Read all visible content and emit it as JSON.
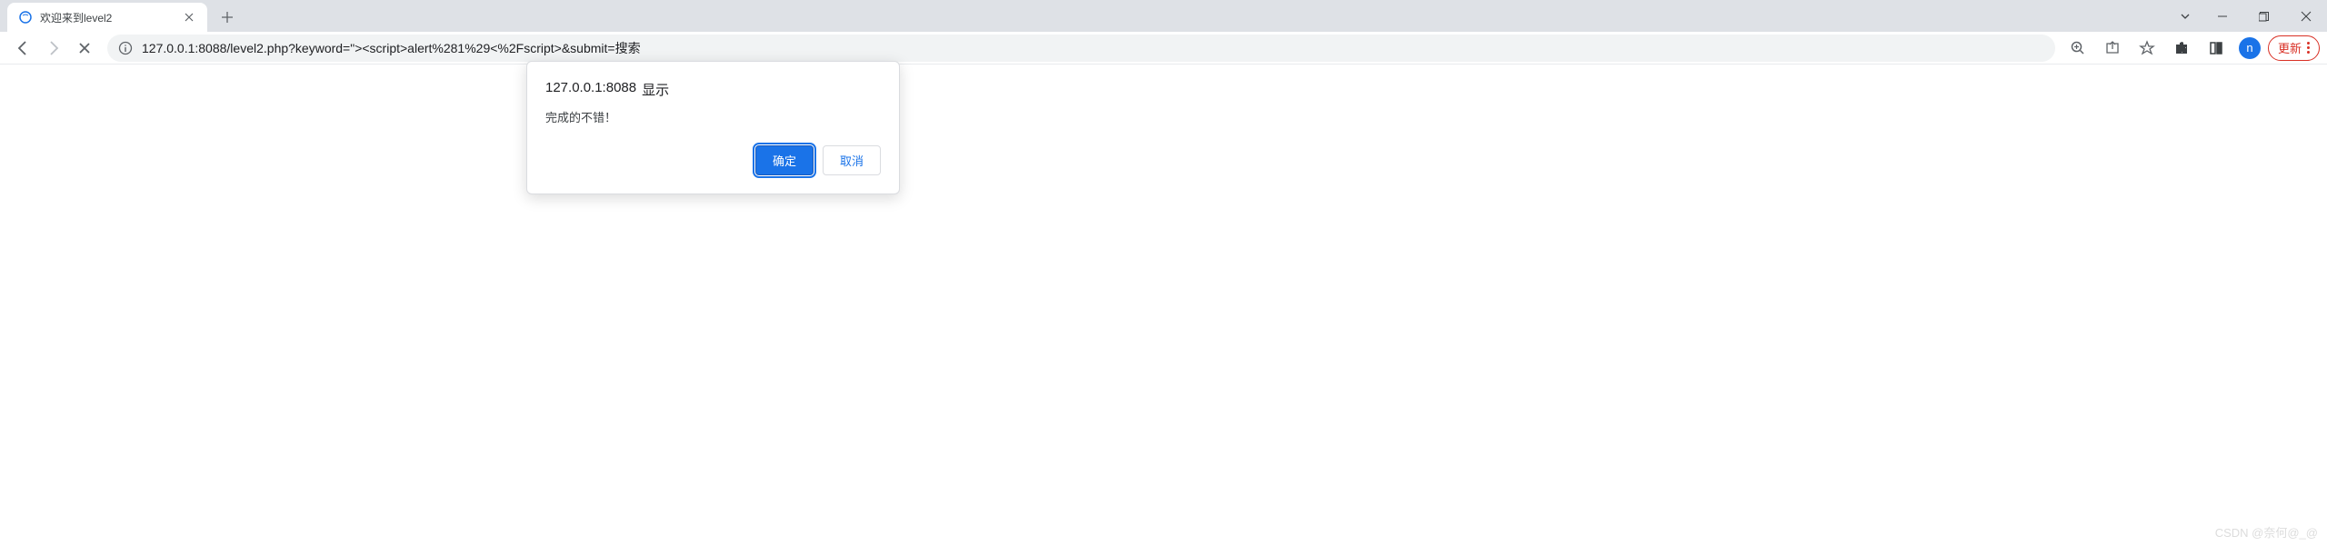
{
  "tab": {
    "title": "欢迎来到level2"
  },
  "url": "127.0.0.1:8088/level2.php?keyword=\"><script>alert%281%29<%2Fscript>&submit=搜索",
  "toolbar": {
    "update_label": "更新"
  },
  "profile": {
    "letter": "n"
  },
  "dialog": {
    "origin": "127.0.0.1:8088",
    "says": "显示",
    "message": "完成的不错！",
    "ok_label": "确定",
    "cancel_label": "取消"
  },
  "watermark": "CSDN @奈何@_@"
}
